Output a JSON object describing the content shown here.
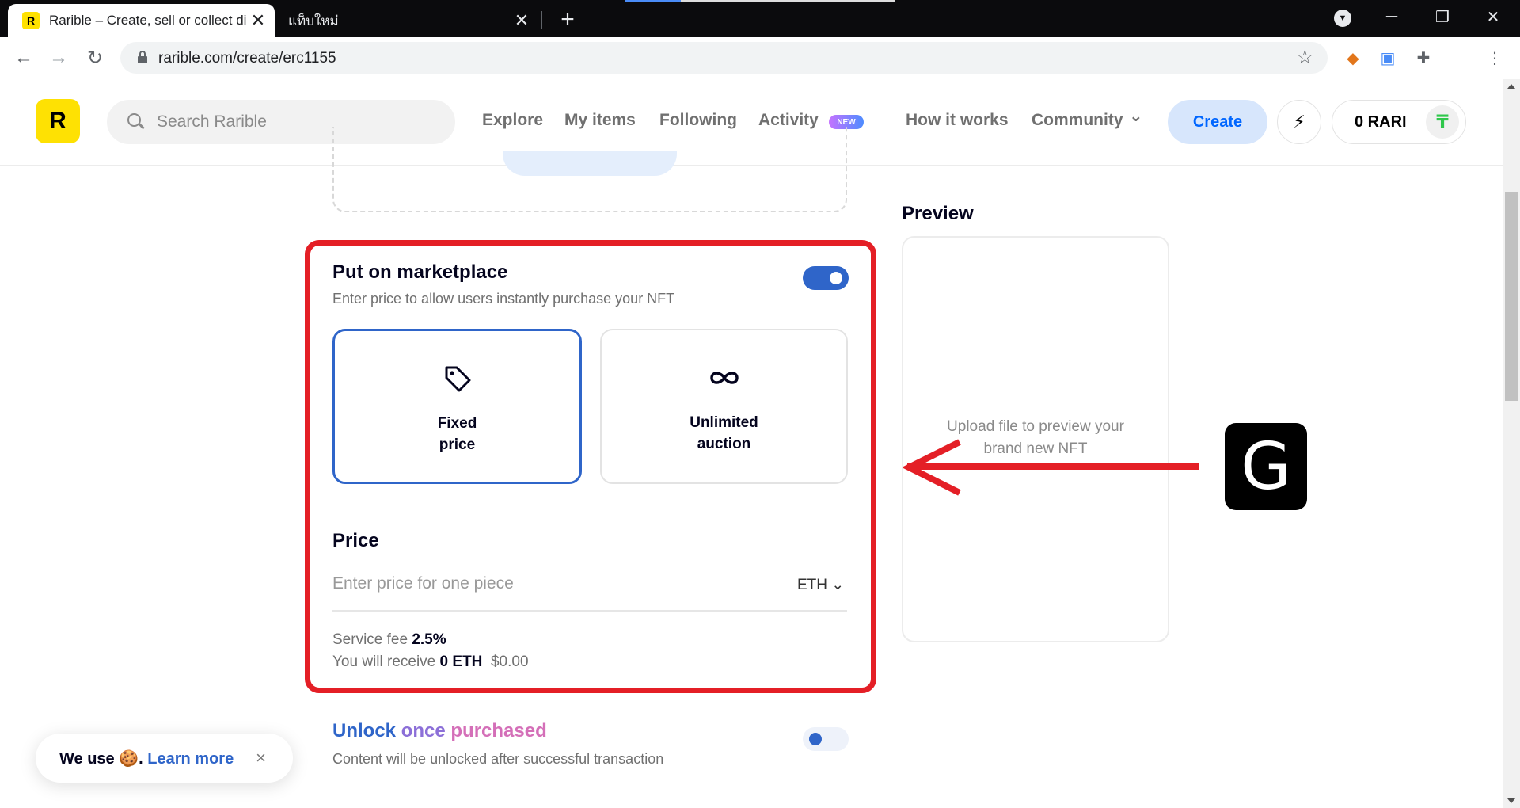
{
  "browser": {
    "active_tab_title": "Rarible – Create, sell or collect di",
    "active_tab_favicon": "R",
    "inactive_tab_title": "แท็บใหม่",
    "tab_close": "✕",
    "new_tab": "+",
    "url": "rarible.com/create/erc1155",
    "window_controls": {
      "minimize": "─",
      "restore": "❐",
      "close": "✕"
    }
  },
  "header": {
    "logo": "R",
    "search_placeholder": "Search Rarible",
    "nav": [
      "Explore",
      "My items",
      "Following",
      "Activity",
      "How it works",
      "Community"
    ],
    "new_badge": "NEW",
    "community_chevron": "⌄",
    "create_label": "Create",
    "bolt_icon": "⚡",
    "balance": "0 RARI",
    "avatar_glyph": "₸"
  },
  "marketplace": {
    "title": "Put on marketplace",
    "subtitle": "Enter price to allow users instantly purchase your NFT",
    "enabled": true,
    "options": [
      {
        "line1": "Fixed",
        "line2": "price",
        "icon": "tag-icon",
        "selected": true
      },
      {
        "line1": "Unlimited",
        "line2": "auction",
        "icon": "infinity-icon",
        "selected": false
      }
    ],
    "price_title": "Price",
    "price_placeholder": "Enter price for one piece",
    "currency": "ETH",
    "service_fee_label": "Service fee",
    "service_fee_value": "2.5%",
    "receive_label": "You will receive",
    "receive_value": "0 ETH",
    "receive_usd": "$0.00"
  },
  "unlock": {
    "word1": "Unlock",
    "word2": "once",
    "word3": "purchased",
    "subtitle": "Content will be unlocked after successful transaction",
    "enabled": false
  },
  "preview": {
    "title": "Preview",
    "line1": "Upload file to preview your",
    "line2": "brand new NFT"
  },
  "cookie": {
    "prefix": "We use",
    "emoji": "🍪",
    "period": ".",
    "link": "Learn more",
    "close": "×"
  },
  "annotation": {
    "badge": "G"
  },
  "colors": {
    "accent": "#2f65c9",
    "brand_yellow": "#fee103",
    "annotation_red": "#e41f26"
  }
}
